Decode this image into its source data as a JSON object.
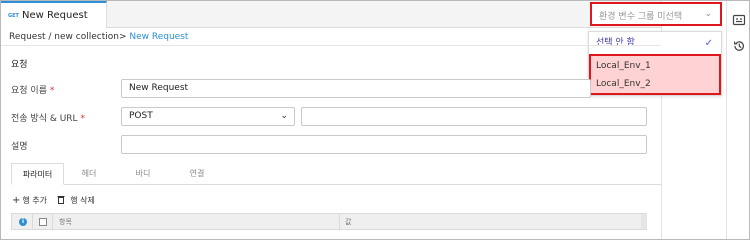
{
  "tab": {
    "method_badge": "GET",
    "title": "New Request"
  },
  "env": {
    "placeholder": "환경 변수 그룹 미선택",
    "options": [
      {
        "label": "선택 안 함",
        "selected": true
      },
      {
        "label": "Local_Env_1",
        "selected": false
      },
      {
        "label": "Local_Env_2",
        "selected": false
      }
    ],
    "highlight_color": "#e0161d"
  },
  "breadcrumb": {
    "path": "Request / new collection",
    "separator": ">",
    "current": " New Request"
  },
  "section": {
    "title": "요청"
  },
  "form": {
    "name_label": "요청 이름",
    "name_required": "*",
    "name_value": "New Request",
    "method_label": "전송 방식 & URL",
    "method_required": "*",
    "method_value": "POST",
    "url_value": "",
    "desc_label": "설명",
    "desc_value": ""
  },
  "subtabs": [
    "파라미터",
    "헤더",
    "바디",
    "연결"
  ],
  "actions": {
    "add_row": "행 추가",
    "delete_row": "행 삭제"
  },
  "grid": {
    "columns": [
      "항목",
      "값"
    ]
  },
  "colors": {
    "accent": "#2d8fd5",
    "alert_border": "#e0161d",
    "alert_fill": "#ffd2d4"
  }
}
